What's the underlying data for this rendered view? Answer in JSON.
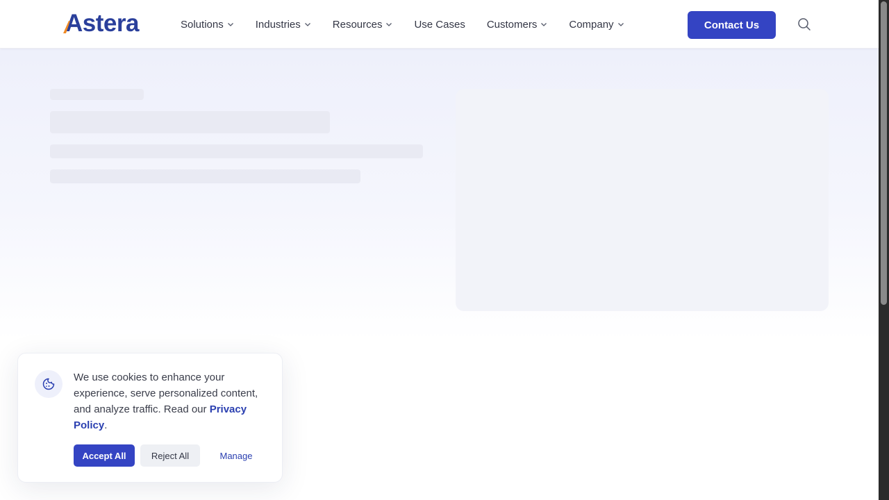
{
  "header": {
    "logo_text": "Astera",
    "nav": [
      {
        "label": "Solutions",
        "has_dropdown": true
      },
      {
        "label": "Industries",
        "has_dropdown": true
      },
      {
        "label": "Resources",
        "has_dropdown": true
      },
      {
        "label": "Use Cases",
        "has_dropdown": false
      },
      {
        "label": "Customers",
        "has_dropdown": true
      },
      {
        "label": "Company",
        "has_dropdown": true
      }
    ],
    "contact_label": "Contact Us",
    "search_icon": "search-icon"
  },
  "cookie_banner": {
    "icon": "cookie-icon",
    "message": "We use cookies to enhance your experience, serve personalized content, and analyze traffic. Read our",
    "policy_link": "Privacy Policy",
    "trailing": ".",
    "accept_label": "Accept All",
    "reject_label": "Reject All",
    "manage_label": "Manage"
  },
  "colors": {
    "brand": "#3444c3",
    "logo": "#2a3f9b",
    "logo_accent": "#f08a24"
  }
}
